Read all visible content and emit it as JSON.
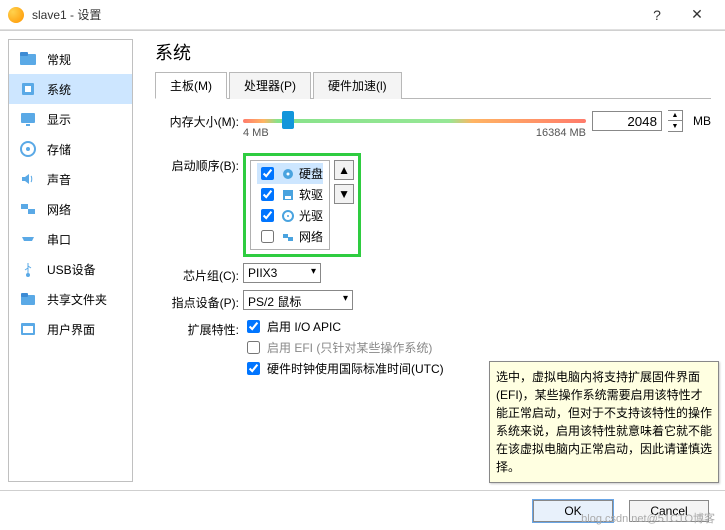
{
  "window": {
    "title": "slave1 - 设置"
  },
  "sidebar": {
    "items": [
      {
        "label": "常规",
        "icon": "folder-icon"
      },
      {
        "label": "系统",
        "icon": "chip-icon"
      },
      {
        "label": "显示",
        "icon": "monitor-icon"
      },
      {
        "label": "存储",
        "icon": "disk-icon"
      },
      {
        "label": "声音",
        "icon": "speaker-icon"
      },
      {
        "label": "网络",
        "icon": "network-icon"
      },
      {
        "label": "串口",
        "icon": "serial-icon"
      },
      {
        "label": "USB设备",
        "icon": "usb-icon"
      },
      {
        "label": "共享文件夹",
        "icon": "share-icon"
      },
      {
        "label": "用户界面",
        "icon": "ui-icon"
      }
    ],
    "active_index": 1
  },
  "page": {
    "heading": "系统",
    "tabs": [
      {
        "label": "主板(M)"
      },
      {
        "label": "处理器(P)"
      },
      {
        "label": "硬件加速(l)"
      }
    ],
    "active_tab": 0
  },
  "memory": {
    "label": "内存大小(M):",
    "value": "2048",
    "unit": "MB",
    "min_label": "4 MB",
    "max_label": "16384 MB"
  },
  "boot": {
    "label": "启动顺序(B):",
    "items": [
      {
        "label": "硬盘",
        "checked": true,
        "icon": "hdd-icon",
        "selected": true
      },
      {
        "label": "软驱",
        "checked": true,
        "icon": "floppy-icon"
      },
      {
        "label": "光驱",
        "checked": true,
        "icon": "optical-icon"
      },
      {
        "label": "网络",
        "checked": false,
        "icon": "net-icon"
      }
    ]
  },
  "chipset": {
    "label": "芯片组(C):",
    "value": "PIIX3"
  },
  "pointing": {
    "label": "指点设备(P):",
    "value": "PS/2 鼠标"
  },
  "extended": {
    "label": "扩展特性:",
    "opts": [
      {
        "label": "启用 I/O APIC",
        "checked": true,
        "disabled": false
      },
      {
        "label": "启用 EFI (只针对某些操作系统)",
        "checked": false,
        "disabled": true
      },
      {
        "label": "硬件时钟使用国际标准时间(UTC)",
        "checked": true,
        "disabled": false
      }
    ]
  },
  "tooltip": {
    "text": "选中，虚拟电脑内将支持扩展固件界面 (EFI)，某些操作系统需要启用该特性才能正常启动，但对于不支持该特性的操作系统来说，启用该特性就意味着它就不能在该虚拟电脑内正常启动，因此请谨慎选择。"
  },
  "buttons": {
    "ok": "OK",
    "cancel": "Cancel"
  },
  "watermark": "blog.csdn.net@51CTO博客"
}
